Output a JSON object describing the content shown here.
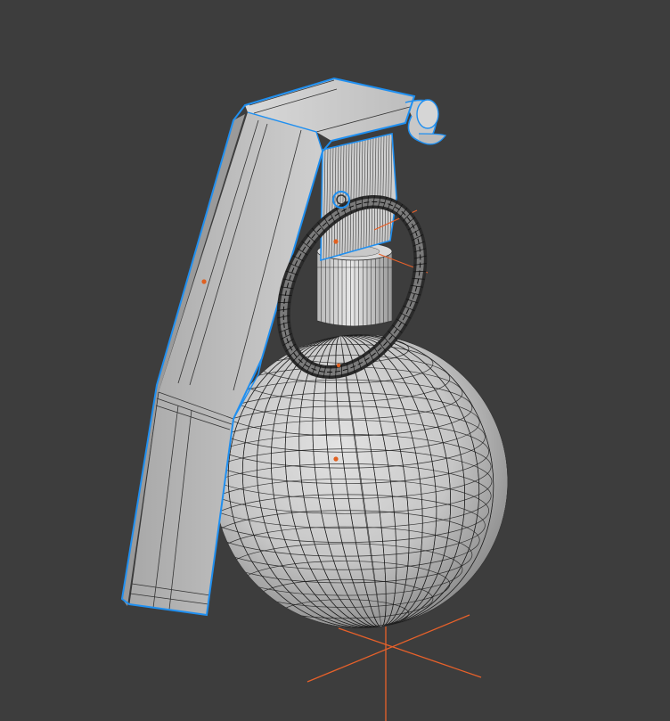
{
  "viewport": {
    "background_color": "#3d3d3d"
  },
  "scene": {
    "objects": [
      "sphere-body",
      "neck",
      "spoon-lever",
      "pull-ring"
    ]
  },
  "colors": {
    "selection_outline": "#1f8ff0",
    "object_origin": "#e06020",
    "cursor_axis": "#e8612a",
    "mesh_light": "#e4e4e4",
    "mesh_dark": "#7c7c7c",
    "ring_dark": "#2a2a2a",
    "wire": "#111111"
  }
}
